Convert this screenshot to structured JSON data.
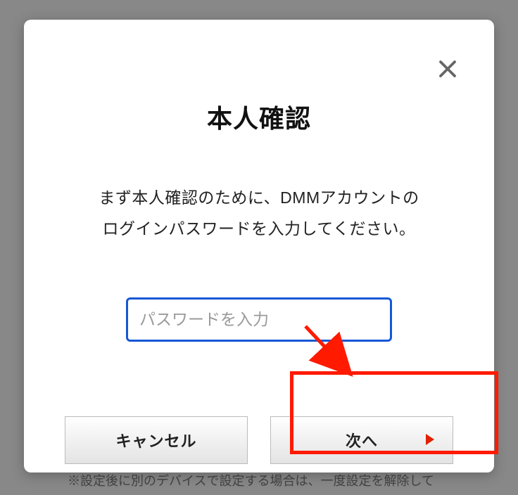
{
  "modal": {
    "title": "本人確認",
    "description_line1": "まず本人確認のために、DMMアカウントの",
    "description_line2": "ログインパスワードを入力してください。",
    "password_placeholder": "パスワードを入力",
    "cancel_label": "キャンセル",
    "next_label": "次へ"
  },
  "background": {
    "partial_text": "※設定後に別のデバイスで設定する場合は、一度設定を解除して"
  }
}
